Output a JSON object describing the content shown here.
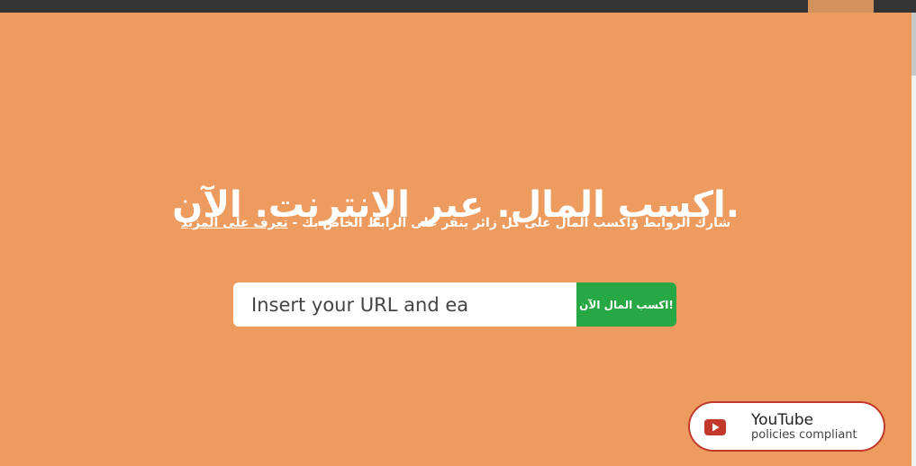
{
  "hero": {
    "title": ".اكسب المال. عبر الإنترنت. الآن",
    "subtitle_text": "شارك الروابط واكسب المال على كل زائر ينقر على الرابط الخاص بك - ",
    "learn_more": "تعرف على المزيد"
  },
  "form": {
    "url_placeholder": "Insert your URL and ea",
    "submit_label": "!اكسب المال الآن"
  },
  "badge": {
    "title": "YouTube",
    "subtitle": "policies compliant"
  },
  "colors": {
    "background": "#ed9b5e",
    "topbar": "#343434",
    "button": "#28a745",
    "youtube_red": "#c0392b"
  },
  "icons": {
    "badge_icon": "youtube-play-icon"
  }
}
